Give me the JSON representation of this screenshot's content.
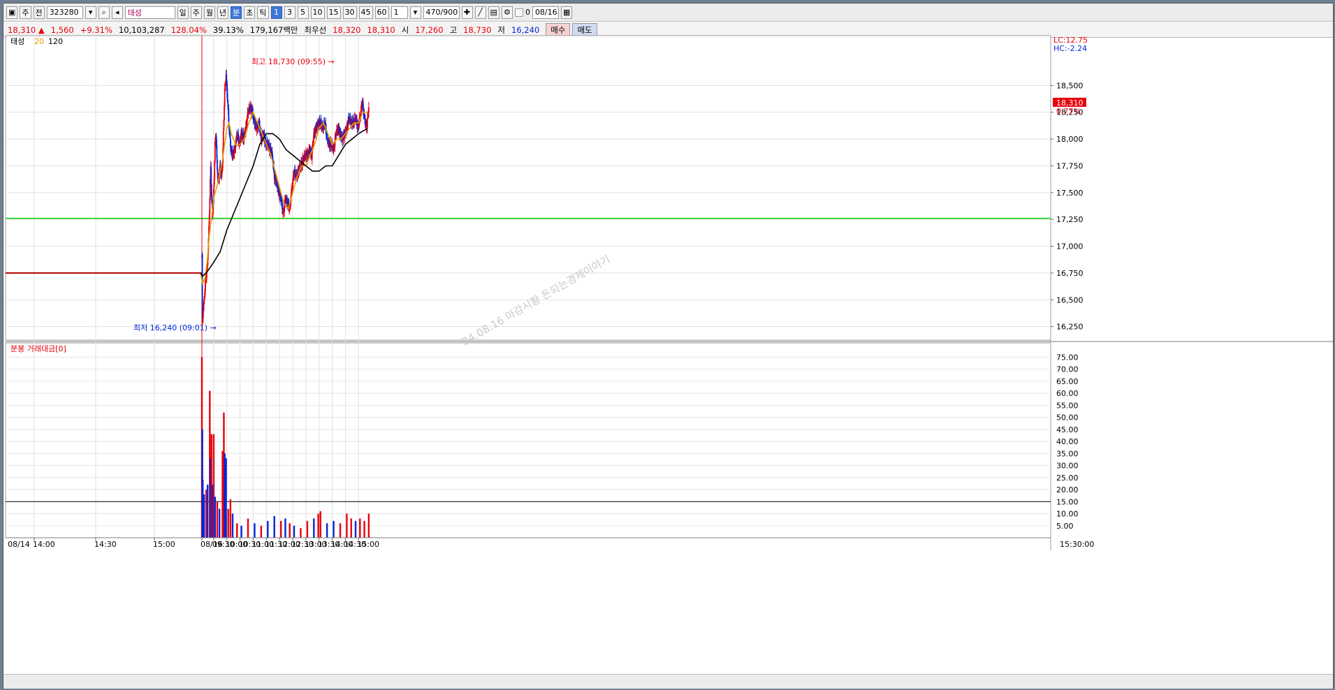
{
  "toolbar": {
    "market": "주",
    "mode": "전",
    "code": "323280",
    "name": "태성",
    "periods": [
      "일",
      "주",
      "월",
      "년",
      "분",
      "초",
      "틱"
    ],
    "selected_period": "분",
    "intervals": [
      "1",
      "3",
      "5",
      "10",
      "15",
      "30",
      "45",
      "60"
    ],
    "selected_interval": "1",
    "multiplier": "1",
    "count": "470/900",
    "checkbox_label": "0",
    "date": "08/16"
  },
  "quote": {
    "price": "18,310",
    "direction": "▲",
    "change": "1,560",
    "change_pct": "+9.31%",
    "volume": "10,103,287",
    "volume_ratio": "128.04%",
    "turnover": "39.13%",
    "amount": "179,167백만",
    "best_bid_label": "최우선",
    "best_ask": "18,320",
    "best_bid": "18,310",
    "open_label": "시",
    "open": "17,260",
    "high_label": "고",
    "high": "18,730",
    "low_label": "저",
    "low": "16,240",
    "buy_label": "매수",
    "sell_label": "매도"
  },
  "price_panel": {
    "legend_name": "태성",
    "ma_short": "20",
    "ma_long": "120",
    "lc": "LC:12.75",
    "hc": "HC:-2.24",
    "current_tag": "18,310",
    "current_pct": "0.77%",
    "high_note": "최고 18,730 (09:55)",
    "low_note": "최저 16,240 (09:01)",
    "watermark": "24.08.16 마감시황 돈되는경제이야기"
  },
  "volume_panel": {
    "legend": "분봉 거래대금[0]"
  },
  "time_axis": {
    "labels": [
      "08/14",
      "14:00",
      "14:30",
      "15:00",
      "08/16",
      "09:30",
      "10:00",
      "10:30",
      "11:00",
      "11:30",
      "12:00",
      "12:30",
      "13:00",
      "13:30",
      "14:00",
      "14:30",
      "15:00",
      "15:30:00"
    ]
  },
  "colors": {
    "up": "#e8000b",
    "down": "#0026d9",
    "ma20": "#e8a000",
    "ma120": "#000000",
    "support": "#00d200",
    "cursor": "#e8000b"
  },
  "chart_data": {
    "type": "candlestick",
    "price_axis": {
      "ticks": [
        16250,
        16500,
        16750,
        17000,
        17250,
        17500,
        17750,
        18000,
        18250,
        18500
      ],
      "tick_labels": [
        "16,250",
        "16,500",
        "16,750",
        "17,000",
        "17,250",
        "17,500",
        "17,750",
        "18,000",
        "18,250",
        "18,500"
      ],
      "ylim": [
        16150,
        18900
      ]
    },
    "volume_axis": {
      "ticks": [
        5,
        10,
        15,
        20,
        25,
        30,
        35,
        40,
        45,
        50,
        55,
        60,
        65,
        70,
        75
      ],
      "tick_labels": [
        "5.00",
        "10.00",
        "15.00",
        "20.00",
        "25.00",
        "30.00",
        "35.00",
        "40.00",
        "45.00",
        "50.00",
        "55.00",
        "60.00",
        "65.00",
        "70.00",
        "75.00"
      ],
      "ylim": [
        0,
        78
      ]
    },
    "previous_close": 16750,
    "support_level": 17260,
    "volume_reference": 15,
    "close_path": [
      [
        "09:00",
        16900
      ],
      [
        "09:01",
        16300
      ],
      [
        "09:03",
        16400
      ],
      [
        "09:06",
        16550
      ],
      [
        "09:09",
        16700
      ],
      [
        "09:12",
        16800
      ],
      [
        "09:15",
        17050
      ],
      [
        "09:18",
        17450
      ],
      [
        "09:20",
        17750
      ],
      [
        "09:22",
        17450
      ],
      [
        "09:24",
        17300
      ],
      [
        "09:26",
        17400
      ],
      [
        "09:28",
        17650
      ],
      [
        "09:30",
        17950
      ],
      [
        "09:32",
        18050
      ],
      [
        "09:34",
        17800
      ],
      [
        "09:36",
        17650
      ],
      [
        "09:38",
        17600
      ],
      [
        "09:40",
        17700
      ],
      [
        "09:42",
        17750
      ],
      [
        "09:44",
        17650
      ],
      [
        "09:46",
        17700
      ],
      [
        "09:48",
        17900
      ],
      [
        "09:50",
        18200
      ],
      [
        "09:52",
        18450
      ],
      [
        "09:55",
        18600
      ],
      [
        "09:58",
        18400
      ],
      [
        "10:00",
        18250
      ],
      [
        "10:02",
        18100
      ],
      [
        "10:04",
        18000
      ],
      [
        "10:06",
        17900
      ],
      [
        "10:10",
        17850
      ],
      [
        "10:15",
        17900
      ],
      [
        "10:20",
        18050
      ],
      [
        "10:25",
        17950
      ],
      [
        "10:30",
        18050
      ],
      [
        "10:35",
        18000
      ],
      [
        "10:40",
        18100
      ],
      [
        "10:45",
        18250
      ],
      [
        "10:50",
        18300
      ],
      [
        "10:55",
        18250
      ],
      [
        "11:00",
        18150
      ],
      [
        "11:05",
        18100
      ],
      [
        "11:10",
        18150
      ],
      [
        "11:15",
        18000
      ],
      [
        "11:20",
        18050
      ],
      [
        "11:25",
        17950
      ],
      [
        "11:30",
        17950
      ],
      [
        "11:35",
        17900
      ],
      [
        "11:40",
        17850
      ],
      [
        "11:45",
        17650
      ],
      [
        "11:50",
        17600
      ],
      [
        "11:55",
        17500
      ],
      [
        "12:00",
        17450
      ],
      [
        "12:05",
        17300
      ],
      [
        "12:10",
        17450
      ],
      [
        "12:15",
        17400
      ],
      [
        "12:20",
        17350
      ],
      [
        "12:25",
        17550
      ],
      [
        "12:30",
        17700
      ],
      [
        "12:35",
        17650
      ],
      [
        "12:40",
        17700
      ],
      [
        "12:45",
        17750
      ],
      [
        "12:50",
        17800
      ],
      [
        "12:55",
        17850
      ],
      [
        "13:00",
        17850
      ],
      [
        "13:05",
        17900
      ],
      [
        "13:10",
        17850
      ],
      [
        "13:15",
        18050
      ],
      [
        "13:20",
        18100
      ],
      [
        "13:25",
        18150
      ],
      [
        "13:30",
        18150
      ],
      [
        "13:35",
        18100
      ],
      [
        "13:40",
        18150
      ],
      [
        "13:45",
        18000
      ],
      [
        "13:50",
        17950
      ],
      [
        "13:55",
        17950
      ],
      [
        "14:00",
        17900
      ],
      [
        "14:05",
        18050
      ],
      [
        "14:10",
        18100
      ],
      [
        "14:15",
        18050
      ],
      [
        "14:20",
        18000
      ],
      [
        "14:25",
        18050
      ],
      [
        "14:30",
        18100
      ],
      [
        "14:35",
        18200
      ],
      [
        "14:40",
        18150
      ],
      [
        "14:45",
        18150
      ],
      [
        "14:50",
        18200
      ],
      [
        "14:55",
        18100
      ],
      [
        "15:00",
        18200
      ],
      [
        "15:05",
        18350
      ],
      [
        "15:10",
        18200
      ],
      [
        "15:15",
        18100
      ],
      [
        "15:20",
        18310
      ]
    ],
    "ma20": [
      [
        "09:00",
        16750
      ],
      [
        "09:05",
        16650
      ],
      [
        "09:10",
        16700
      ],
      [
        "09:15",
        16850
      ],
      [
        "09:20",
        17100
      ],
      [
        "09:25",
        17250
      ],
      [
        "09:30",
        17450
      ],
      [
        "09:40",
        17600
      ],
      [
        "09:50",
        17800
      ],
      [
        "10:00",
        18100
      ],
      [
        "10:05",
        18150
      ],
      [
        "10:10",
        18050
      ],
      [
        "10:20",
        17950
      ],
      [
        "10:30",
        17950
      ],
      [
        "10:40",
        18000
      ],
      [
        "10:50",
        18150
      ],
      [
        "11:00",
        18250
      ],
      [
        "11:10",
        18150
      ],
      [
        "11:20",
        18050
      ],
      [
        "11:30",
        17950
      ],
      [
        "11:40",
        17850
      ],
      [
        "11:50",
        17700
      ],
      [
        "12:00",
        17550
      ],
      [
        "12:10",
        17400
      ],
      [
        "12:20",
        17350
      ],
      [
        "12:30",
        17500
      ],
      [
        "12:40",
        17650
      ],
      [
        "12:50",
        17750
      ],
      [
        "13:00",
        17750
      ],
      [
        "13:10",
        17850
      ],
      [
        "13:20",
        17950
      ],
      [
        "13:30",
        18100
      ],
      [
        "13:40",
        18150
      ],
      [
        "13:50",
        18050
      ],
      [
        "14:00",
        17950
      ],
      [
        "14:10",
        18000
      ],
      [
        "14:20",
        18000
      ],
      [
        "14:30",
        18050
      ],
      [
        "14:40",
        18100
      ],
      [
        "14:50",
        18150
      ],
      [
        "15:00",
        18150
      ],
      [
        "15:10",
        18250
      ],
      [
        "15:20",
        18250
      ]
    ],
    "ma120": [
      [
        "09:00",
        16750
      ],
      [
        "09:05",
        16720
      ],
      [
        "09:15",
        16760
      ],
      [
        "09:30",
        16850
      ],
      [
        "09:45",
        16950
      ],
      [
        "10:00",
        17150
      ],
      [
        "10:15",
        17300
      ],
      [
        "10:30",
        17450
      ],
      [
        "10:45",
        17600
      ],
      [
        "11:00",
        17750
      ],
      [
        "11:15",
        17950
      ],
      [
        "11:30",
        18050
      ],
      [
        "11:45",
        18050
      ],
      [
        "12:00",
        18000
      ],
      [
        "12:15",
        17900
      ],
      [
        "12:30",
        17850
      ],
      [
        "12:45",
        17800
      ],
      [
        "13:00",
        17750
      ],
      [
        "13:15",
        17700
      ],
      [
        "13:30",
        17700
      ],
      [
        "13:45",
        17750
      ],
      [
        "14:00",
        17750
      ],
      [
        "14:15",
        17850
      ],
      [
        "14:30",
        17950
      ],
      [
        "14:45",
        18000
      ],
      [
        "15:00",
        18050
      ],
      [
        "15:20",
        18100
      ]
    ],
    "volume": [
      [
        "09:00",
        75,
        "up"
      ],
      [
        "09:01",
        45,
        "down"
      ],
      [
        "09:02",
        24,
        "down"
      ],
      [
        "09:05",
        18,
        "down"
      ],
      [
        "09:10",
        20,
        "up"
      ],
      [
        "09:13",
        22,
        "down"
      ],
      [
        "09:18",
        61,
        "up"
      ],
      [
        "09:19",
        33,
        "down"
      ],
      [
        "09:22",
        43,
        "up"
      ],
      [
        "09:24",
        22,
        "down"
      ],
      [
        "09:27",
        43,
        "up"
      ],
      [
        "09:30",
        17,
        "down"
      ],
      [
        "09:35",
        15,
        "up"
      ],
      [
        "09:40",
        12,
        "down"
      ],
      [
        "09:47",
        36,
        "up"
      ],
      [
        "09:50",
        52,
        "up"
      ],
      [
        "09:52",
        35,
        "down"
      ],
      [
        "09:55",
        33,
        "down"
      ],
      [
        "10:00",
        12,
        "up"
      ],
      [
        "10:05",
        16,
        "up"
      ],
      [
        "10:10",
        10,
        "down"
      ],
      [
        "10:20",
        6,
        "up"
      ],
      [
        "10:30",
        5,
        "down"
      ],
      [
        "10:45",
        8,
        "up"
      ],
      [
        "11:00",
        6,
        "down"
      ],
      [
        "11:15",
        5,
        "up"
      ],
      [
        "11:30",
        7,
        "down"
      ],
      [
        "11:45",
        9,
        "down"
      ],
      [
        "12:00",
        7,
        "up"
      ],
      [
        "12:10",
        8,
        "down"
      ],
      [
        "12:20",
        6,
        "up"
      ],
      [
        "12:30",
        5,
        "down"
      ],
      [
        "12:45",
        4,
        "up"
      ],
      [
        "13:00",
        7,
        "up"
      ],
      [
        "13:15",
        8,
        "down"
      ],
      [
        "13:25",
        10,
        "up"
      ],
      [
        "13:30",
        11,
        "up"
      ],
      [
        "13:45",
        6,
        "down"
      ],
      [
        "14:00",
        7,
        "down"
      ],
      [
        "14:15",
        6,
        "up"
      ],
      [
        "14:30",
        10,
        "up"
      ],
      [
        "14:40",
        8,
        "up"
      ],
      [
        "14:50",
        7,
        "down"
      ],
      [
        "15:00",
        8,
        "up"
      ],
      [
        "15:10",
        7,
        "up"
      ],
      [
        "15:20",
        10,
        "up"
      ]
    ]
  }
}
